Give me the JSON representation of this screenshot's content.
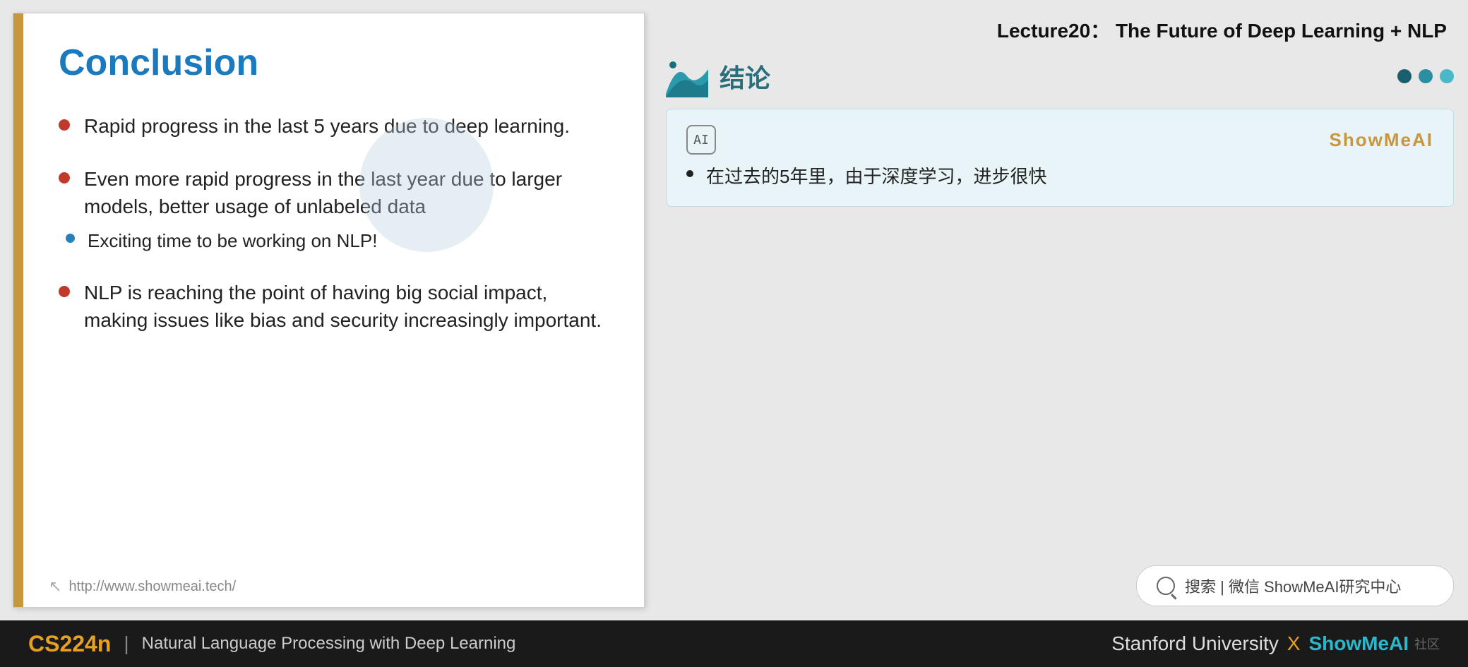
{
  "slide": {
    "title": "Conclusion",
    "left_bar_color": "#c8963c",
    "bullets": [
      {
        "text": "Rapid progress in the last 5 years due to deep learning.",
        "sub_bullets": []
      },
      {
        "text": "Even more rapid progress in the last year due to larger models, better usage of unlabeled data",
        "sub_bullets": [
          "Exciting time to be working on NLP!"
        ]
      },
      {
        "text": "NLP is reaching the point of having big social impact, making issues like bias and security increasingly important.",
        "sub_bullets": []
      }
    ],
    "footer_url": "http://www.showmeai.tech/"
  },
  "right_panel": {
    "lecture_title": "Lecture20： The Future of Deep Learning + NLP",
    "section_icon": "wave",
    "section_title_cn": "结论",
    "nav_dots": [
      "dark",
      "mid",
      "light"
    ],
    "translation_card": {
      "ai_label": "AI",
      "brand": "ShowMeAI",
      "bullets": [
        "在过去的5年里，由于深度学习，进步很快"
      ]
    },
    "search_bar": {
      "icon": "search",
      "text": "搜索 | 微信 ShowMeAI研究中心"
    }
  },
  "bottom_bar": {
    "course_code": "CS224n",
    "separator": "|",
    "course_desc": "Natural Language Processing with Deep Learning",
    "university": "Stanford University",
    "x_mark": "X",
    "brand": "ShowMeAI",
    "watermark": "社区"
  }
}
